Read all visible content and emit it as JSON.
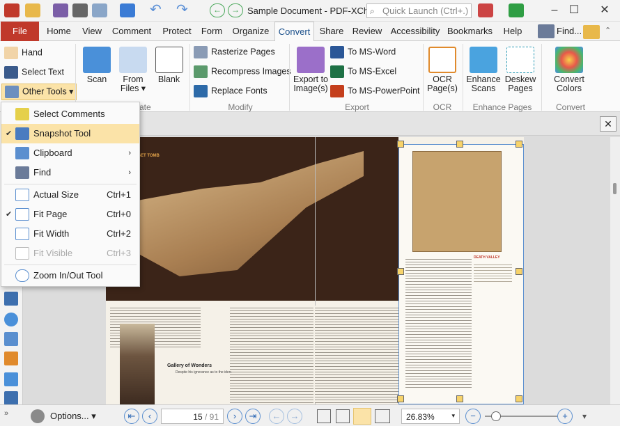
{
  "app": {
    "title": "Sample Document - PDF-XCha...",
    "quick_launch_placeholder": "Quick Launch (Ctrl+.)"
  },
  "tabs": [
    "File",
    "Home",
    "View",
    "Comment",
    "Protect",
    "Form",
    "Organize",
    "Convert",
    "Share",
    "Review",
    "Accessibility",
    "Bookmarks",
    "Help"
  ],
  "find_label": "Find...",
  "ribbon": {
    "tools": {
      "hand": "Hand",
      "select_text": "Select Text",
      "other_tools": "Other Tools"
    },
    "create": {
      "scan": "Scan",
      "from_files": [
        "From",
        "Files"
      ],
      "blank": "Blank"
    },
    "modify": {
      "rasterize": "Rasterize Pages",
      "recompress": "Recompress Images",
      "replace_fonts": "Replace Fonts",
      "group": "Modify"
    },
    "export": {
      "export_to_images": [
        "Export to",
        "Image(s)"
      ],
      "to_word": "To MS-Word",
      "to_excel": "To MS-Excel",
      "to_powerpoint": "To MS-PowerPoint",
      "group": "Export"
    },
    "ocr": {
      "ocr_pages": [
        "OCR",
        "Page(s)"
      ],
      "group": "OCR"
    },
    "enhance": {
      "enhance_scans": [
        "Enhance",
        "Scans"
      ],
      "deskew": [
        "Deskew",
        "Pages"
      ],
      "group": "Enhance Pages"
    },
    "colors": {
      "convert_colors": [
        "Convert",
        "Colors"
      ],
      "group": "Convert Colors"
    },
    "partial_group": "ate"
  },
  "menu": [
    {
      "label": "Select Comments",
      "shortcut": "",
      "checked": false,
      "submenu": false,
      "disabled": false,
      "highlight": false
    },
    {
      "label": "Snapshot Tool",
      "shortcut": "",
      "checked": true,
      "submenu": false,
      "disabled": false,
      "highlight": true
    },
    {
      "label": "Clipboard",
      "shortcut": "",
      "checked": false,
      "submenu": true,
      "disabled": false,
      "highlight": false
    },
    {
      "label": "Find",
      "shortcut": "",
      "checked": false,
      "submenu": true,
      "disabled": false,
      "highlight": false
    },
    {
      "label": "Actual Size",
      "shortcut": "Ctrl+1",
      "checked": false,
      "submenu": false,
      "disabled": false,
      "highlight": false
    },
    {
      "label": "Fit Page",
      "shortcut": "Ctrl+0",
      "checked": true,
      "submenu": false,
      "disabled": false,
      "highlight": false
    },
    {
      "label": "Fit Width",
      "shortcut": "Ctrl+2",
      "checked": false,
      "submenu": false,
      "disabled": false,
      "highlight": false
    },
    {
      "label": "Fit Visible",
      "shortcut": "Ctrl+3",
      "checked": false,
      "submenu": false,
      "disabled": true,
      "highlight": false
    },
    {
      "label": "Zoom In/Out Tool",
      "shortcut": "",
      "checked": false,
      "submenu": false,
      "disabled": false,
      "highlight": false
    }
  ],
  "document": {
    "headings": {
      "tomb": "SET TOMB",
      "gallery": "Gallery of Wonders",
      "death": "DEATH VALLEY"
    },
    "caption": "Despite his ignorance as to the iden-"
  },
  "status": {
    "options": "Options...",
    "page_current": "15",
    "page_total": "/ 91",
    "zoom": "26.83%"
  },
  "colors": {
    "file_tab": "#c0392b",
    "accent": "#1a4f8a",
    "highlight": "#fbe3a8"
  }
}
